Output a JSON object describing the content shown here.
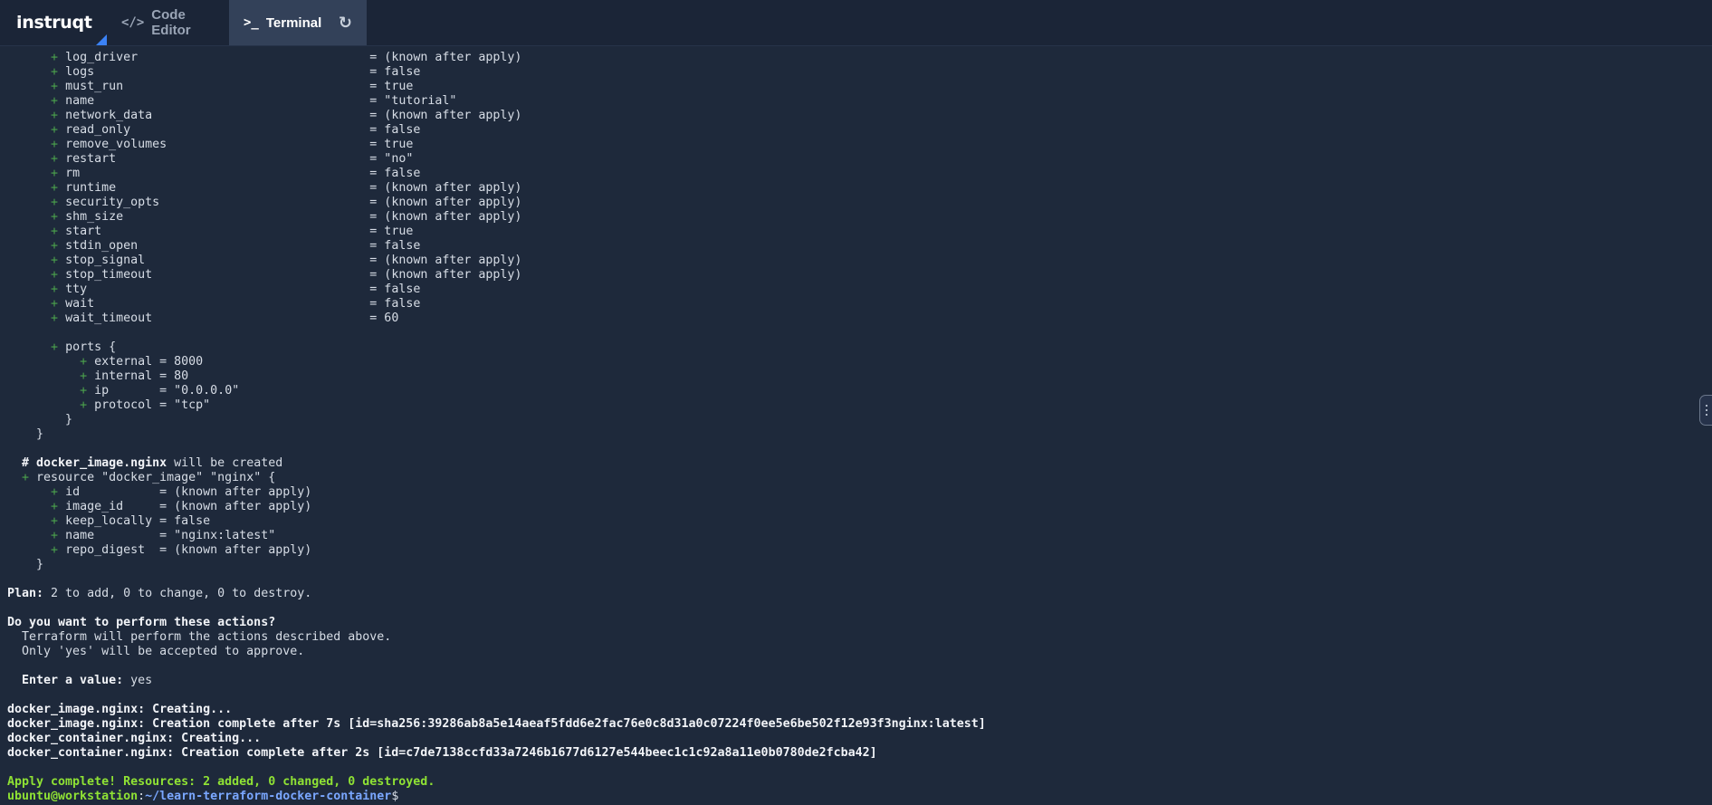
{
  "app": {
    "logo_text": "instruqt"
  },
  "tabs": [
    {
      "label": "Code Editor",
      "icon": "</>"
    },
    {
      "label": "Terminal",
      "icon": ">_"
    }
  ],
  "refresh_icon": "↻",
  "colors": {
    "background": "#1e293b",
    "active_tab": "#334159",
    "plus": "#4ca34c",
    "success": "#8fe234",
    "path": "#7aa7ff"
  },
  "terminal": {
    "lines": [
      {
        "type": "attr",
        "indent": "      ",
        "key": "log_driver                                ",
        "value": "= (known after apply)"
      },
      {
        "type": "attr",
        "indent": "      ",
        "key": "logs                                      ",
        "value": "= false"
      },
      {
        "type": "attr",
        "indent": "      ",
        "key": "must_run                                  ",
        "value": "= true"
      },
      {
        "type": "attr",
        "indent": "      ",
        "key": "name                                      ",
        "value": "= \"tutorial\""
      },
      {
        "type": "attr",
        "indent": "      ",
        "key": "network_data                              ",
        "value": "= (known after apply)"
      },
      {
        "type": "attr",
        "indent": "      ",
        "key": "read_only                                 ",
        "value": "= false"
      },
      {
        "type": "attr",
        "indent": "      ",
        "key": "remove_volumes                            ",
        "value": "= true"
      },
      {
        "type": "attr",
        "indent": "      ",
        "key": "restart                                   ",
        "value": "= \"no\""
      },
      {
        "type": "attr",
        "indent": "      ",
        "key": "rm                                        ",
        "value": "= false"
      },
      {
        "type": "attr",
        "indent": "      ",
        "key": "runtime                                   ",
        "value": "= (known after apply)"
      },
      {
        "type": "attr",
        "indent": "      ",
        "key": "security_opts                             ",
        "value": "= (known after apply)"
      },
      {
        "type": "attr",
        "indent": "      ",
        "key": "shm_size                                  ",
        "value": "= (known after apply)"
      },
      {
        "type": "attr",
        "indent": "      ",
        "key": "start                                     ",
        "value": "= true"
      },
      {
        "type": "attr",
        "indent": "      ",
        "key": "stdin_open                                ",
        "value": "= false"
      },
      {
        "type": "attr",
        "indent": "      ",
        "key": "stop_signal                               ",
        "value": "= (known after apply)"
      },
      {
        "type": "attr",
        "indent": "      ",
        "key": "stop_timeout                              ",
        "value": "= (known after apply)"
      },
      {
        "type": "attr",
        "indent": "      ",
        "key": "tty                                       ",
        "value": "= false"
      },
      {
        "type": "attr",
        "indent": "      ",
        "key": "wait                                      ",
        "value": "= false"
      },
      {
        "type": "attr",
        "indent": "      ",
        "key": "wait_timeout                              ",
        "value": "= 60"
      },
      {
        "type": "blank"
      },
      {
        "type": "attr",
        "indent": "      ",
        "key": "ports {",
        "value": ""
      },
      {
        "type": "attr",
        "indent": "          ",
        "key": "external ",
        "value": "= 8000"
      },
      {
        "type": "attr",
        "indent": "          ",
        "key": "internal ",
        "value": "= 80"
      },
      {
        "type": "attr",
        "indent": "          ",
        "key": "ip       ",
        "value": "= \"0.0.0.0\""
      },
      {
        "type": "attr",
        "indent": "          ",
        "key": "protocol ",
        "value": "= \"tcp\""
      },
      {
        "type": "text",
        "text": "        }"
      },
      {
        "type": "text",
        "text": "    }"
      },
      {
        "type": "blank"
      },
      {
        "type": "comment",
        "prefix": "  # ",
        "bold": "docker_image.nginx",
        "rest": " will be created"
      },
      {
        "type": "attr",
        "indent": "  ",
        "key": "resource \"docker_image\" \"nginx\" {",
        "value": ""
      },
      {
        "type": "attr",
        "indent": "      ",
        "key": "id           ",
        "value": "= (known after apply)"
      },
      {
        "type": "attr",
        "indent": "      ",
        "key": "image_id     ",
        "value": "= (known after apply)"
      },
      {
        "type": "attr",
        "indent": "      ",
        "key": "keep_locally ",
        "value": "= false"
      },
      {
        "type": "attr",
        "indent": "      ",
        "key": "name         ",
        "value": "= \"nginx:latest\""
      },
      {
        "type": "attr",
        "indent": "      ",
        "key": "repo_digest  ",
        "value": "= (known after apply)"
      },
      {
        "type": "text",
        "text": "    }"
      },
      {
        "type": "blank"
      },
      {
        "type": "labeled",
        "bold": "Plan:",
        "rest": " 2 to add, 0 to change, 0 to destroy."
      },
      {
        "type": "blank"
      },
      {
        "type": "bold",
        "text": "Do you want to perform these actions?"
      },
      {
        "type": "text",
        "text": "  Terraform will perform the actions described above."
      },
      {
        "type": "text",
        "text": "  Only 'yes' will be accepted to approve."
      },
      {
        "type": "blank"
      },
      {
        "type": "labeled",
        "bold": "  Enter a value:",
        "rest": " yes"
      },
      {
        "type": "blank"
      },
      {
        "type": "labeled",
        "bold": "docker_image.nginx: Creating...",
        "rest": ""
      },
      {
        "type": "labeled",
        "bold": "docker_image.nginx: Creation complete after 7s [id=sha256:39286ab8a5e14aeaf5fdd6e2fac76e0c8d31a0c07224f0ee5e6be502f12e93f3nginx:latest]",
        "rest": ""
      },
      {
        "type": "labeled",
        "bold": "docker_container.nginx: Creating...",
        "rest": ""
      },
      {
        "type": "labeled",
        "bold": "docker_container.nginx: Creation complete after 2s [id=c7de7138ccfd33a7246b1677d6127e544beec1c1c92a8a11e0b0780de2fcba42]",
        "rest": ""
      },
      {
        "type": "blank"
      },
      {
        "type": "success",
        "text": "Apply complete! Resources: 2 added, 0 changed, 0 destroyed."
      },
      {
        "type": "prompt",
        "user": "ubuntu@workstation",
        "sep": ":",
        "path": "~/learn-terraform-docker-container",
        "suffix": "$"
      }
    ]
  }
}
